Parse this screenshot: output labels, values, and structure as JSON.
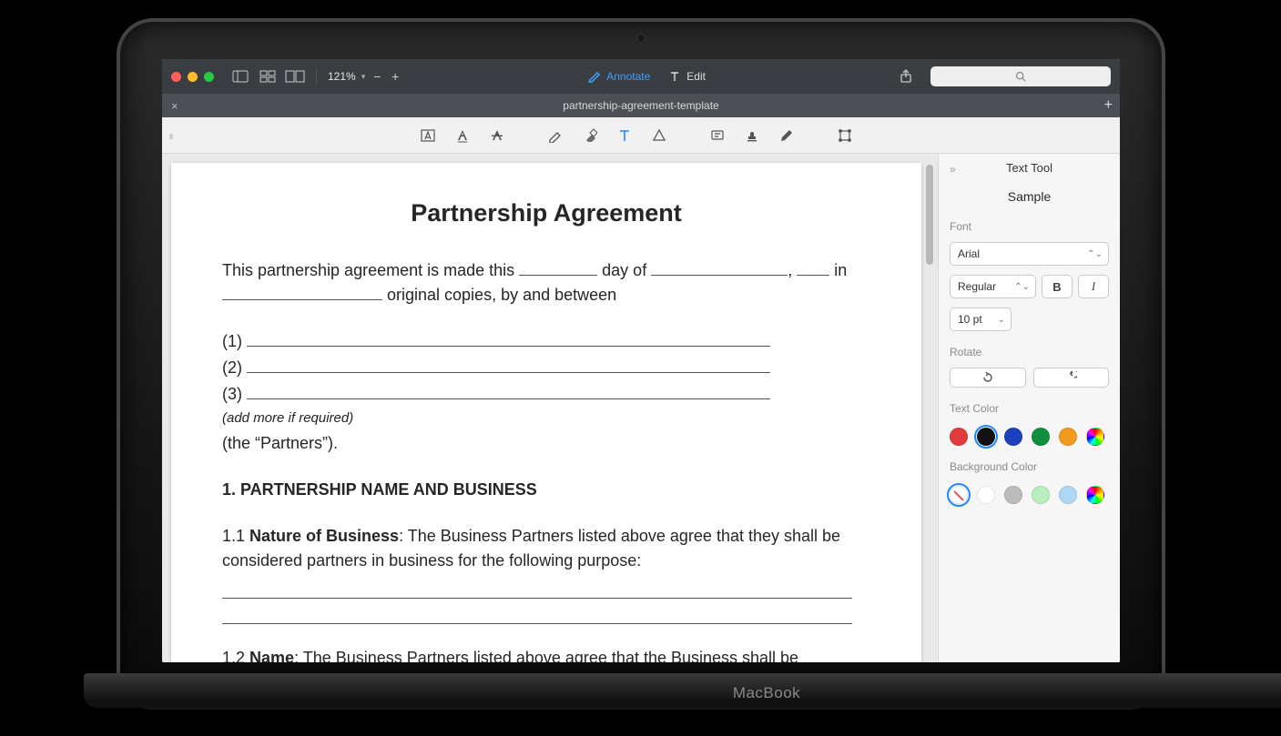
{
  "toolbar": {
    "zoom": "121%",
    "annotate": "Annotate",
    "edit": "Edit"
  },
  "tab": {
    "title": "partnership-agreement-template"
  },
  "sidepanel": {
    "title": "Text Tool",
    "sample": "Sample",
    "font_label": "Font",
    "font_value": "Arial",
    "weight_value": "Regular",
    "size_value": "10 pt",
    "rotate_label": "Rotate",
    "textcolor_label": "Text Color",
    "bgcolor_label": "Background Color",
    "text_colors": [
      "#e23b3b",
      "#111111",
      "#1d3fbf",
      "#0f8f3f",
      "#f39a1c",
      "rainbow"
    ],
    "text_color_selected": 1,
    "bg_colors": [
      "none",
      "#ffffff",
      "#bcbcbc",
      "#b7f0be",
      "#aed7f5",
      "rainbow"
    ],
    "bg_color_selected": 0
  },
  "doc": {
    "title": "Partnership Agreement",
    "intro_a": "This partnership agreement is made this ",
    "intro_b": " day of ",
    "intro_c": ", ",
    "intro_d": " in ",
    "intro_e": " original copies, by and between",
    "p1": "(1) ",
    "p2": "(2) ",
    "p3": "(3) ",
    "more": "(add more if required)",
    "partners": "(the “Partners”).",
    "sec1": "1. PARTNERSHIP NAME AND BUSINESS",
    "s11_a": "1.1 ",
    "s11_b": "Nature of Business",
    "s11_c": ": The Business Partners listed above agree that they shall be considered partners in business for the following purpose:",
    "s12_a": "1.2 ",
    "s12_b": "Name",
    "s12_c": ": The Business Partners listed above agree that the Business shall be conducted in the following name:"
  },
  "device": {
    "label": "MacBook"
  }
}
